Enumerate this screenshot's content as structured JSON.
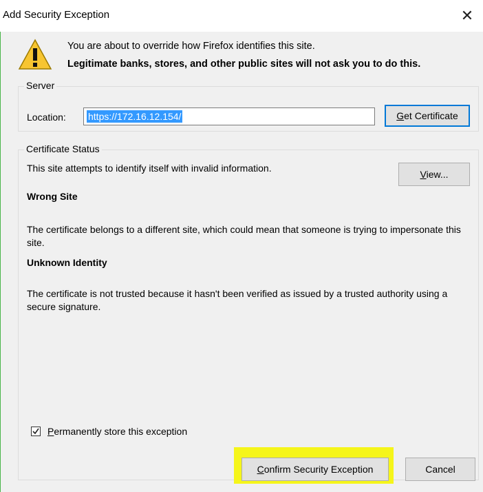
{
  "window": {
    "title": "Add Security Exception",
    "close_glyph": "✕"
  },
  "warning": {
    "icon": "warning-triangle-icon",
    "line1": "You are about to override how Firefox identifies this site.",
    "line2": "Legitimate banks, stores, and other public sites will not ask you to do this."
  },
  "server": {
    "legend": "Server",
    "location_label": "Location:",
    "location_value": "https://172.16.12.154/",
    "get_certificate": {
      "mnemonic": "G",
      "rest": "et Certificate"
    }
  },
  "status": {
    "legend": "Certificate Status",
    "summary": "This site attempts to identify itself with invalid information.",
    "view": {
      "mnemonic": "V",
      "rest": "iew..."
    },
    "wrong_site_title": "Wrong Site",
    "wrong_site_desc": "The certificate belongs to a different site, which could mean that someone is trying to impersonate this site.",
    "unknown_identity_title": "Unknown Identity",
    "unknown_identity_desc": "The certificate is not trusted because it hasn't been verified as issued by a trusted authority using a secure signature."
  },
  "store": {
    "checked": true,
    "mnemonic": "P",
    "rest": "ermanently store this exception"
  },
  "buttons": {
    "confirm": {
      "mnemonic": "C",
      "rest": "onfirm Security Exception"
    },
    "cancel": "Cancel"
  },
  "colors": {
    "highlight": "#f5f51a",
    "selection": "#3399ff",
    "focus_border": "#0078d7",
    "warning_yellow": "#f7c531"
  }
}
